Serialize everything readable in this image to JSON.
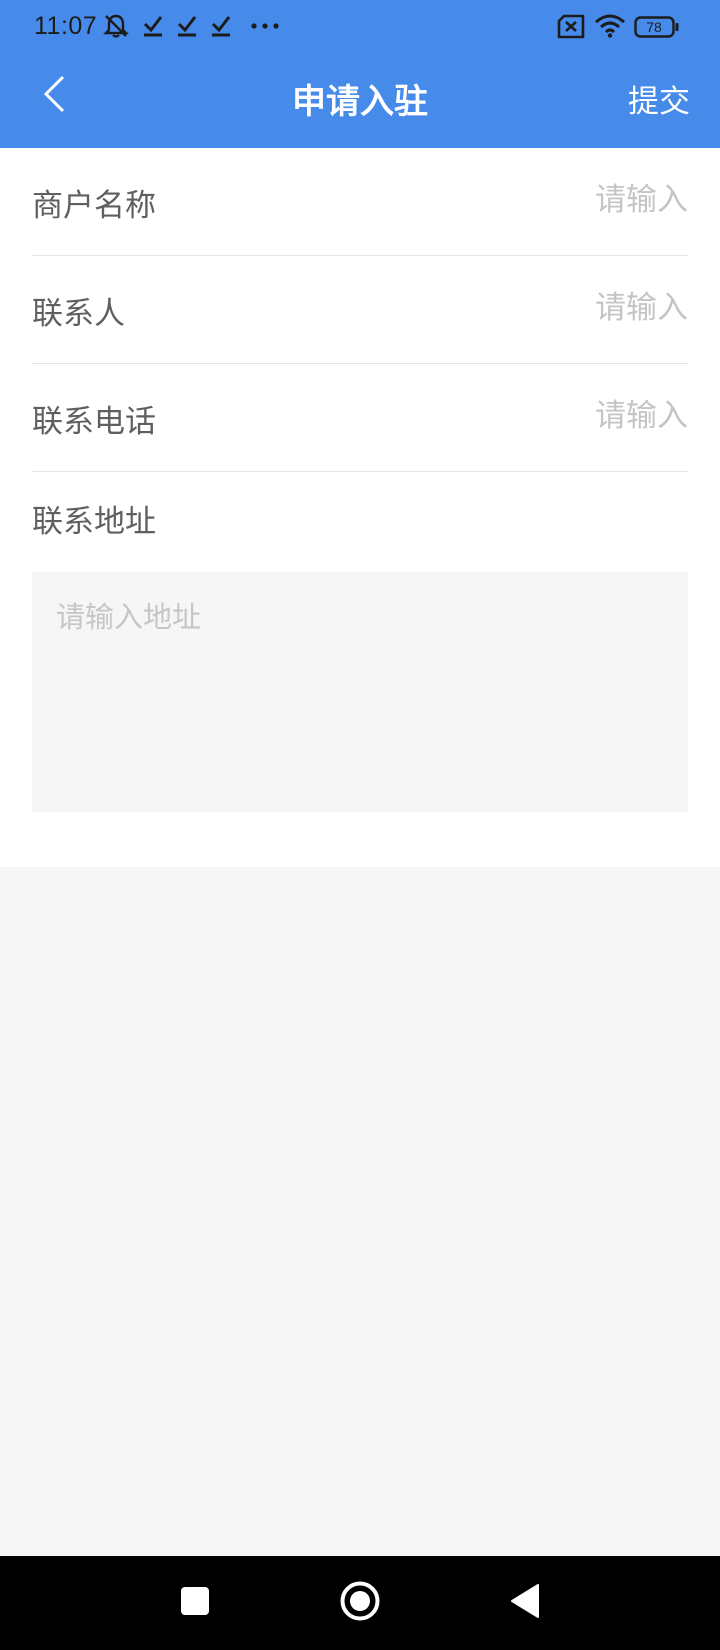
{
  "status_bar": {
    "time": "11:07",
    "icons": [
      "mute-icon",
      "check-download-icon",
      "check-download-icon",
      "check-download-icon",
      "more-dots-icon",
      "sim-x-icon",
      "wifi-icon",
      "battery-icon"
    ],
    "battery_level": "78"
  },
  "header": {
    "title": "申请入驻",
    "submit_label": "提交",
    "background_color": "#468bea"
  },
  "form": {
    "fields": [
      {
        "label": "商户名称",
        "placeholder": "请输入"
      },
      {
        "label": "联系人",
        "placeholder": "请输入"
      },
      {
        "label": "联系电话",
        "placeholder": "请输入"
      }
    ],
    "address": {
      "label": "联系地址",
      "placeholder": "请输入地址"
    }
  },
  "system_nav": {
    "buttons": [
      "recents-square-icon",
      "home-circle-icon",
      "back-triangle-icon"
    ]
  }
}
